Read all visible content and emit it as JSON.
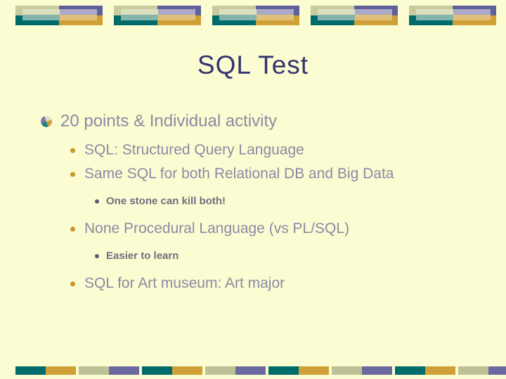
{
  "slide": {
    "title": "SQL Test",
    "background_color": "#fcfcd2",
    "title_color": "#33336e",
    "body_text_color": "#8a8aa6"
  },
  "decoration": {
    "top_band_name": "top-decorative-band",
    "bottom_band_name": "bottom-decorative-band",
    "colors": {
      "sage": "#c8cc9c",
      "purple": "#5f5f9a",
      "teal": "#006b6b",
      "gold": "#cfa036",
      "sage_light": "#dcdfbe",
      "purple_light": "#aaaac8",
      "teal_light": "#83b5ad",
      "gold_light": "#e0c079"
    },
    "top_units": 5,
    "bottom_segments": 16
  },
  "bullets": [
    {
      "level": 1,
      "text": "20 points & Individual activity",
      "bullet": "pinwheel-bullet-icon"
    },
    {
      "level": 2,
      "text": "SQL: Structured Query Language",
      "bullet": "gold-dot-bullet-icon"
    },
    {
      "level": 2,
      "text": "Same SQL for both Relational DB and Big Data",
      "bullet": "gold-dot-bullet-icon"
    },
    {
      "level": 3,
      "text": "One stone can kill both!",
      "bullet": "dark-dot-bullet-icon"
    },
    {
      "level": 2,
      "text": "None Procedural Language (vs PL/SQL)",
      "bullet": "gold-dot-bullet-icon"
    },
    {
      "level": 3,
      "text": "Easier to learn",
      "bullet": "dark-dot-bullet-icon"
    },
    {
      "level": 2,
      "text": "SQL for Art museum: Art major",
      "bullet": "gold-dot-bullet-icon"
    }
  ]
}
